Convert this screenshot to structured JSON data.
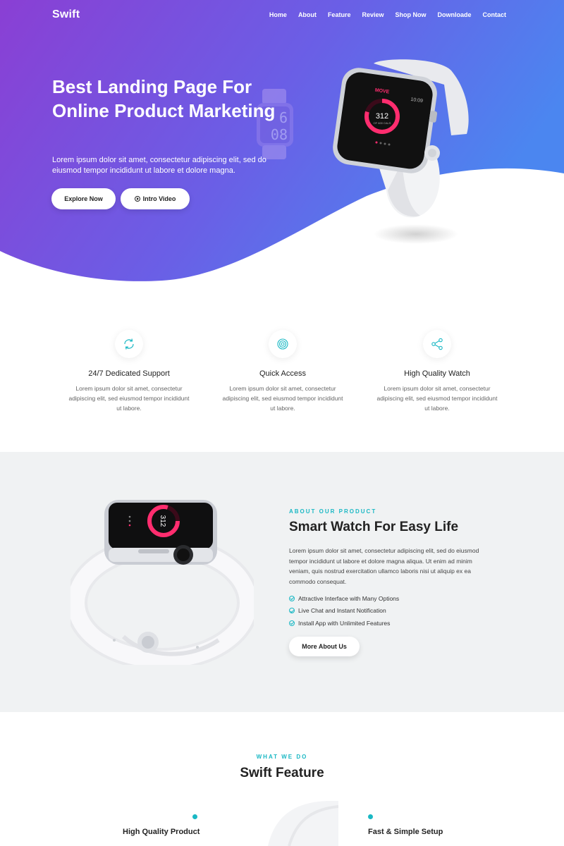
{
  "brand": {
    "name": "Swift"
  },
  "nav": {
    "items": [
      "Home",
      "About",
      "Feature",
      "Review",
      "Shop Now",
      "Downloade",
      "Contact"
    ]
  },
  "hero": {
    "title": "Best Landing Page For Online Product Marketing",
    "text": "Lorem ipsum dolor sit amet, consectetur adipiscing elit, sed do eiusmod tempor incididunt ut labore et dolore magna.",
    "explore_label": "Explore Now",
    "video_label": "Intro Video",
    "watch_screen": {
      "label": "MOVE",
      "time": "10:09",
      "value": "312",
      "unit": "OF 600 CALS"
    },
    "ghost_time": {
      "top": "6",
      "bottom": "08"
    }
  },
  "features": [
    {
      "icon": "refresh-icon",
      "title": "24/7 Dedicated Support",
      "text": "Lorem ipsum dolor sit amet, consectetur adipiscing elit, sed eiusmod tempor incididunt ut labore."
    },
    {
      "icon": "target-icon",
      "title": "Quick Access",
      "text": "Lorem ipsum dolor sit amet, consectetur adipiscing elit, sed eiusmod tempor incididunt ut labore."
    },
    {
      "icon": "share-icon",
      "title": "High Quality Watch",
      "text": "Lorem ipsum dolor sit amet, consectetur adipiscing elit, sed eiusmod tempor incididunt ut labore."
    }
  ],
  "about": {
    "kicker": "ABOUT OUR PRODUCT",
    "title": "Smart Watch For Easy Life",
    "text": "Lorem ipsum dolor sit amet, consectetur adipiscing elit, sed do eiusmod tempor incididunt ut labore et dolore magna aliqua. Ut enim ad minim veniam, quis nostrud exercitation ullamco laboris nisi ut aliquip ex ea commodo consequat.",
    "list": [
      "Attractive Interface with Many Options",
      "Live Chat and Instant Notification",
      "Install App with Unlimited Features"
    ],
    "button_label": "More About Us",
    "watch_value": "312"
  },
  "what_we_do": {
    "kicker": "WHAT WE DO",
    "title": "Swift Feature",
    "left_title": "High Quality Product",
    "right_title": "Fast & Simple Setup"
  },
  "colors": {
    "gradient_start": "#8a3fd4",
    "gradient_end": "#4b86f0",
    "accent": "#1ab8c4",
    "ring": "#ff2d6f"
  }
}
